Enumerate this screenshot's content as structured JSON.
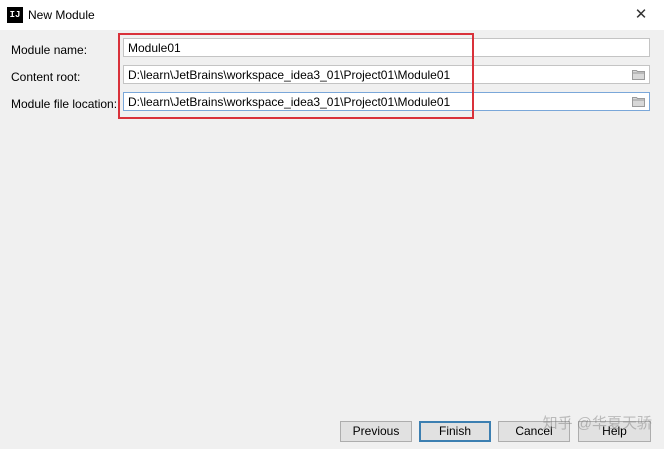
{
  "window": {
    "title": "New Module",
    "app_icon_text": "IJ",
    "close_symbol": "✕"
  },
  "form": {
    "module_name": {
      "label": "Module name:",
      "value": "Module01"
    },
    "content_root": {
      "label": "Content root:",
      "value": "D:\\learn\\JetBrains\\workspace_idea3_01\\Project01\\Module01"
    },
    "module_file_location": {
      "label": "Module file location:",
      "value": "D:\\learn\\JetBrains\\workspace_idea3_01\\Project01\\Module01"
    }
  },
  "buttons": {
    "previous": "Previous",
    "finish": "Finish",
    "cancel": "Cancel",
    "help": "Help"
  },
  "watermark": "知乎 @华夏天骄",
  "colors": {
    "highlight": "#d9313a",
    "focus_border": "#7aa7d9",
    "default_button_border": "#3c7fb1"
  },
  "icons": [
    "intellij-icon",
    "close-icon",
    "folder-icon"
  ]
}
